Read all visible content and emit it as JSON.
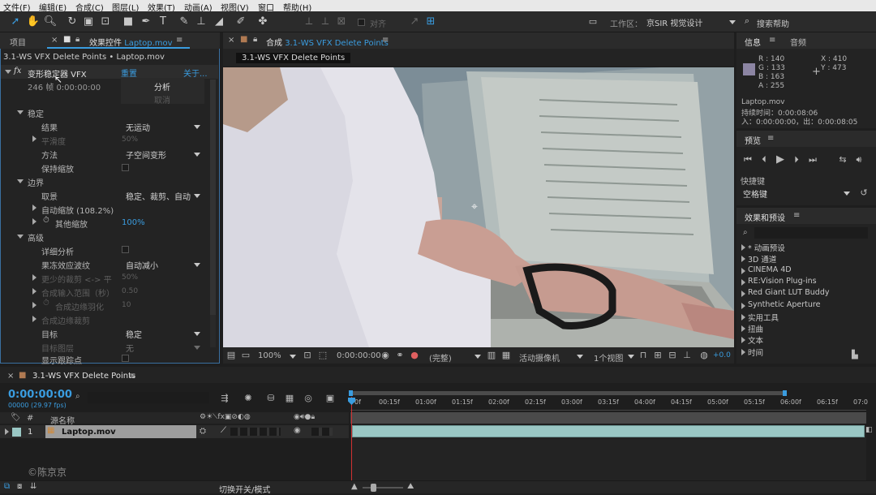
{
  "menu": [
    "文件(F)",
    "编辑(E)",
    "合成(C)",
    "图层(L)",
    "效果(T)",
    "动画(A)",
    "视图(V)",
    "窗口",
    "帮助(H)"
  ],
  "toolbar": {
    "align_label": "对齐",
    "workspace_label": "工作区：",
    "workspace_value": "京SIR 视觉设计",
    "search_help": "搜索帮助"
  },
  "left_panel": {
    "tab_project": "项目",
    "tab_effects_prefix": "效果控件",
    "tab_effects_file": "Laptop.mov",
    "breadcrumb": "3.1-WS VFX Delete Points • Laptop.mov",
    "fx_name": "变形稳定器 VFX",
    "reset": "重置",
    "about": "关于...",
    "frames_info": "246 帧 0:00:00:00",
    "analyze_btn": "分析",
    "cancel_btn": "取消",
    "sections": {
      "stabilize": "稳定",
      "result": "结果",
      "result_value": "无运动",
      "smoothness": "平滑度",
      "smoothness_value": "50%",
      "method": "方法",
      "method_value": "子空间变形",
      "preserve_scale": "保持缩放",
      "borders": "边界",
      "framing": "取景",
      "framing_value": "稳定、裁剪、自动",
      "auto_scale": "自动缩放 (108.2%)",
      "additional_scale": "其他缩放",
      "additional_scale_value": "100%",
      "advanced": "高级",
      "detailed_analysis": "详细分析",
      "rolling_shutter": "果冻效应波纹",
      "rolling_shutter_value": "自动减小",
      "crop_less": "更少的裁剪 <-> 平",
      "crop_less_value": "50%",
      "synth_input": "合成输入范围（秒）",
      "synth_input_value": "0.50",
      "synth_feather": "合成边缘羽化",
      "synth_feather_value": "10",
      "synth_crop": "合成边缘裁剪",
      "target": "目标",
      "target_value": "稳定",
      "target_layer": "目标图层",
      "target_layer_value": "无",
      "show_track": "显示跟踪点"
    }
  },
  "comp_panel": {
    "tab_prefix": "合成",
    "tab_name": "3.1-WS VFX Delete Points",
    "flow_chip": "3.1-WS VFX Delete Points",
    "zoom": "100%",
    "timecode": "0:00:00:00",
    "resolution": "(完整)",
    "camera": "活动摄像机",
    "views": "1个视图",
    "exposure": "+0.0"
  },
  "info_panel": {
    "tab_info": "信息",
    "tab_audio": "音频",
    "r": "R : 140",
    "g": "G : 133",
    "b": "B : 163",
    "a": "A : 255",
    "x": "X : 410",
    "y": "Y : 473",
    "swatch_color": "#8c85a3",
    "file": "Laptop.mov",
    "duration": "持续时间：0:00:08:06",
    "inout": "入：0:00:00:00，出：0:00:08:05"
  },
  "preview_panel": {
    "title": "预览",
    "shortcut_label": "快捷键",
    "shortcut_value": "空格键"
  },
  "effects_presets": {
    "title": "效果和预设",
    "items": [
      "* 动画预设",
      "3D 通道",
      "CINEMA 4D",
      "RE:Vision Plug-ins",
      "Red Giant LUT Buddy",
      "Synthetic Aperture",
      "实用工具",
      "扭曲",
      "文本",
      "时间"
    ]
  },
  "timeline": {
    "tab_name": "3.1-WS VFX Delete Points",
    "timecode": "0:00:00:00",
    "frame_info": "00000 (29.97 fps)",
    "col_hash": "#",
    "col_source": "源名称",
    "layer_num": "1",
    "layer_name": "Laptop.mov",
    "ruler": [
      "0f",
      "00:15f",
      "01:00f",
      "01:15f",
      "02:00f",
      "02:15f",
      "03:00f",
      "03:15f",
      "04:00f",
      "04:15f",
      "05:00f",
      "05:15f",
      "06:00f",
      "06:15f",
      "07:0"
    ],
    "watermark": "©陈京京",
    "toggle_modes": "切换开关/模式"
  },
  "colors": {
    "accent": "#3a9cdf",
    "clip": "#9ac7c4",
    "playhead": "#d03030"
  }
}
